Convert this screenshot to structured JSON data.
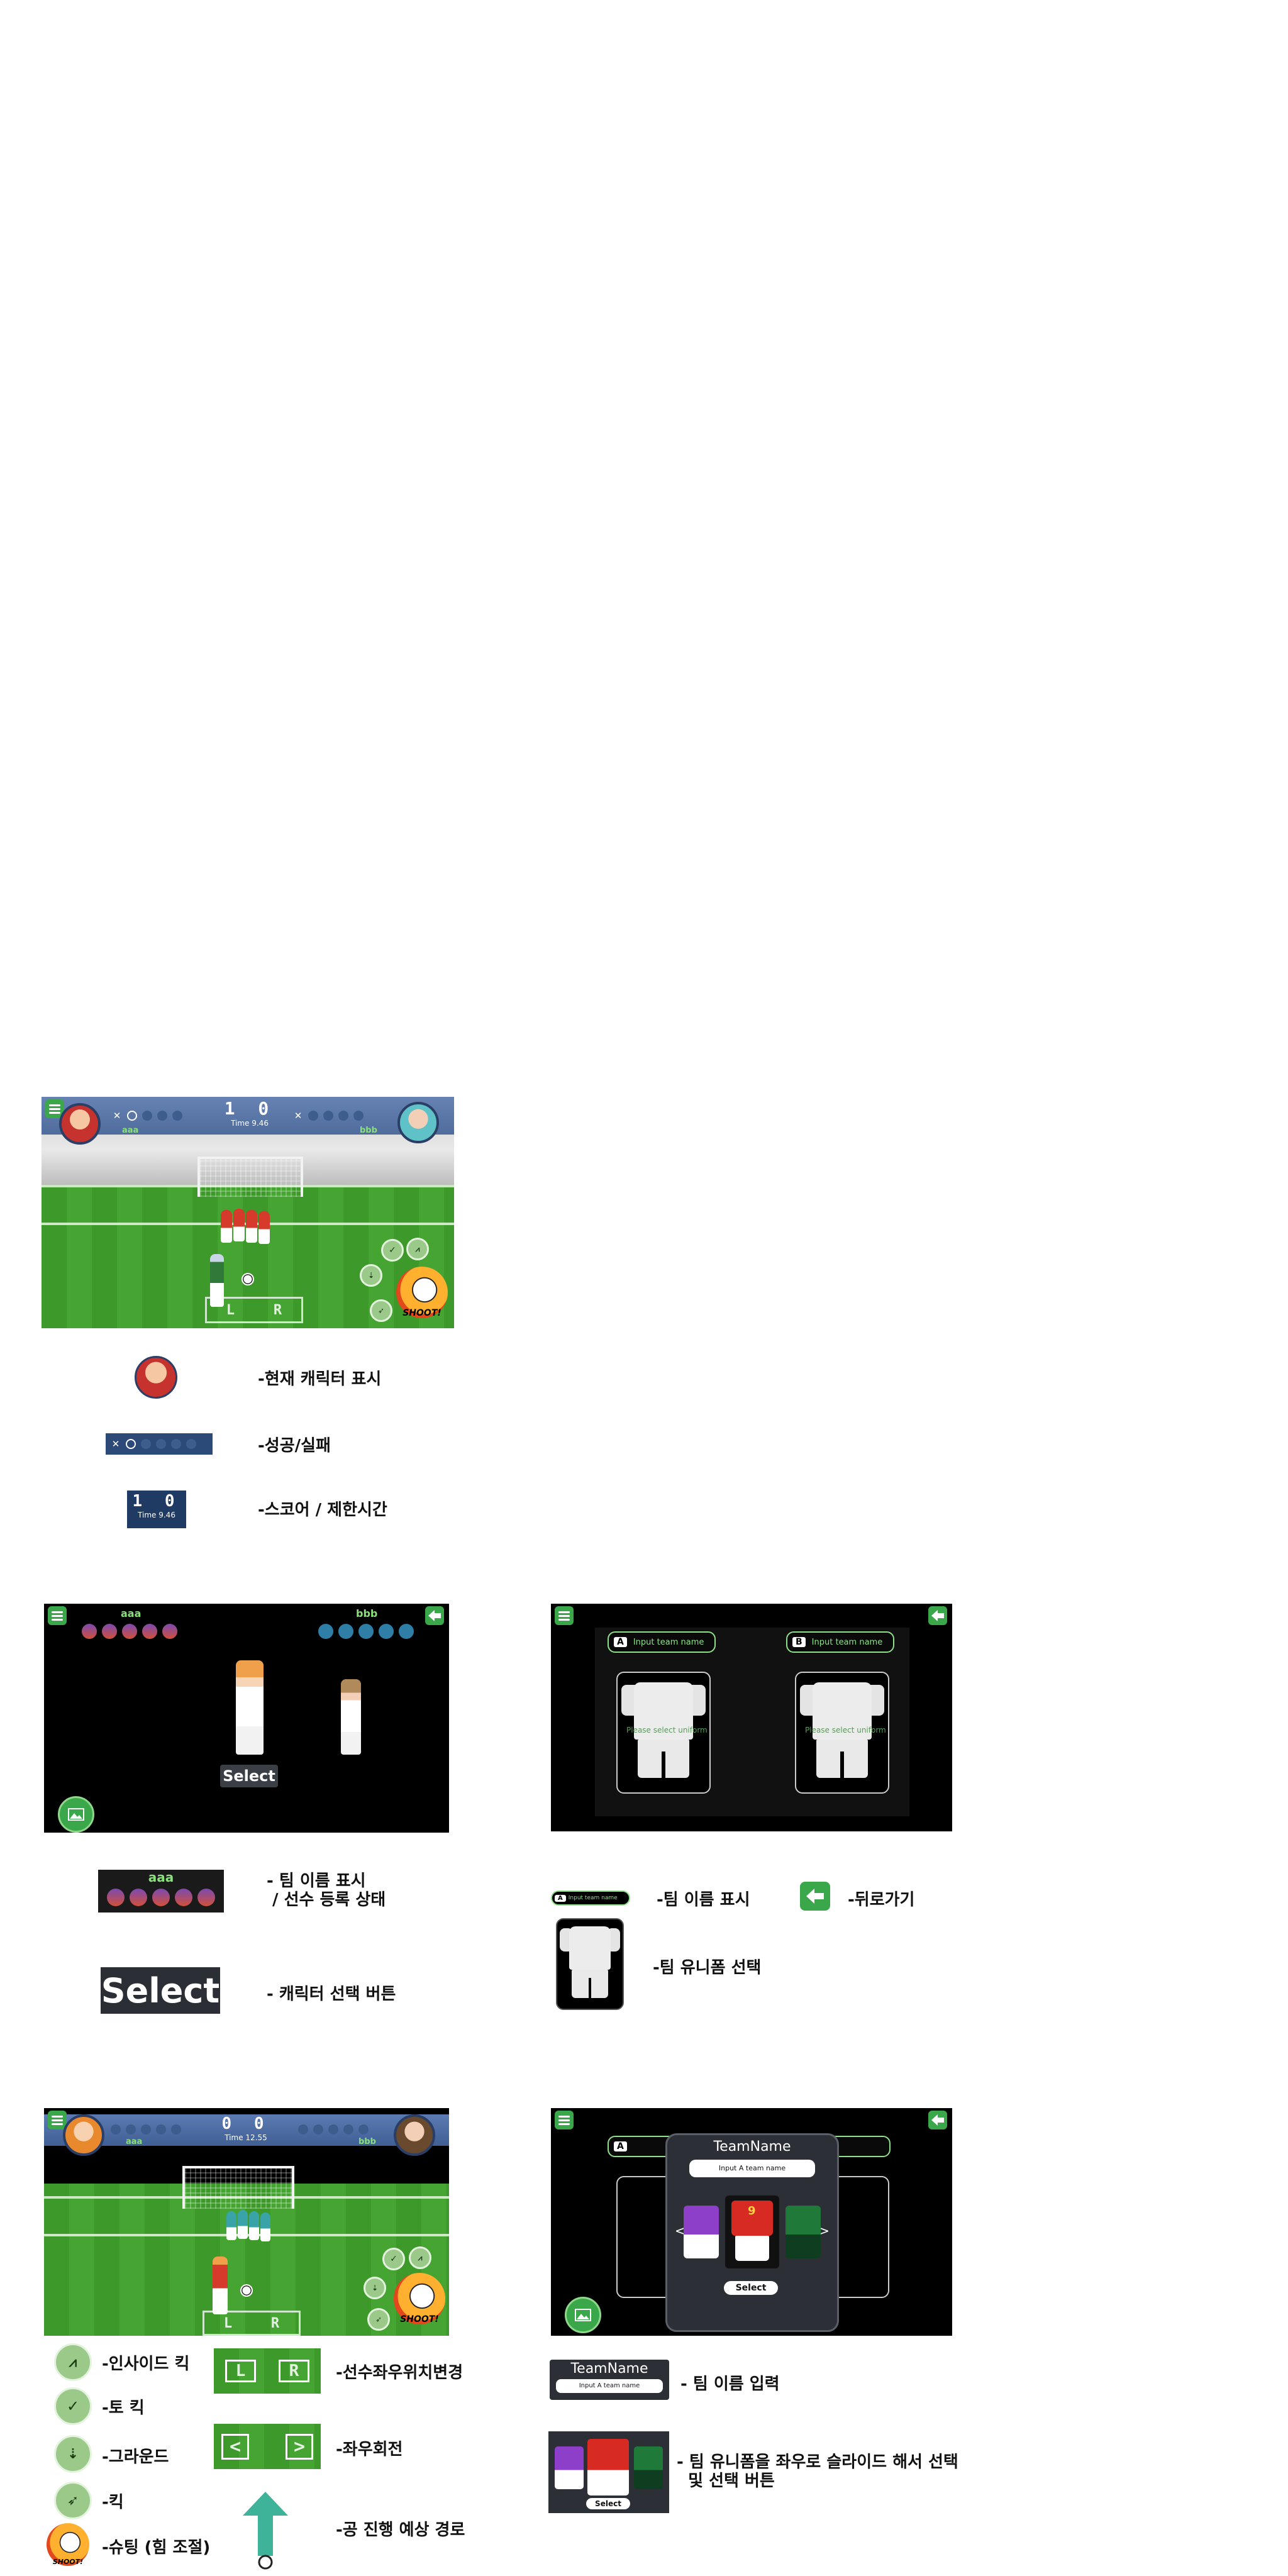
{
  "s1": {
    "score": "1 0",
    "time": "Time  9.46",
    "team_a": "aaa",
    "team_b": "bbb",
    "lr_left": "L",
    "lr_right": "R",
    "shoot": "SHOOT!",
    "legend": {
      "character": "-현재 캐릭터 표시",
      "success": "-성공/실패",
      "score_time": "-스코어 / 제한시간",
      "mini_score": "1 0",
      "mini_time": "Time  9.46"
    }
  },
  "s2": {
    "team_a": "aaa",
    "team_b": "bbb",
    "select": "Select",
    "legend": {
      "team_label": "aaa",
      "team_display": "- 팀 이름 표시\n / 선수 등록 상태",
      "select_big": "Select",
      "select_desc": "- 캐릭터 선택 버튼"
    }
  },
  "s3": {
    "a_letter": "A",
    "b_letter": "B",
    "input_placeholder": "Input team name",
    "ghost_text": "Please select uniform",
    "legend": {
      "mini_letter": "A",
      "mini_placeholder": "Input team name",
      "team_name_desc": "-팀 이름 표시",
      "back_desc": "-뒤로가기",
      "uniform_desc": "-팀 유니폼 선택"
    }
  },
  "s4": {
    "score": "0 0",
    "time": "Time  12.55",
    "team_a": "aaa",
    "team_b": "bbb",
    "lr_left": "L",
    "lr_right": "R",
    "shoot": "SHOOT!",
    "legend": {
      "inside_kick": "-인사이드 킥",
      "toe_kick": "-토 킥",
      "ground": "-그라운드",
      "kick": "-킥",
      "shooting": "-슈팅 (힘 조절)",
      "pos_change": "-선수좌우위치변경",
      "rotate": "-좌우회전",
      "path": "-공 진행 예상 경로",
      "pad_l": "L",
      "pad_r": "R",
      "arrow_l": "<",
      "arrow_r": ">"
    }
  },
  "s5": {
    "a_letter": "A",
    "popup_title": "TeamName",
    "popup_input": "Input A team name",
    "popup_select": "Select",
    "kit_number": "9",
    "prev": "<",
    "next": ">",
    "legend": {
      "title": "TeamName",
      "input": "Input A team name",
      "name_desc": "- 팀 이름 입력",
      "slide_desc": "- 팀 유니폼을 좌우로 슬라이드 해서 선택\n  및 선택 버튼",
      "select": "Select"
    }
  },
  "colors": {
    "accent_green": "#3aa84a",
    "score_blue": "#2c4a78",
    "grass": "#3d9a2a"
  }
}
